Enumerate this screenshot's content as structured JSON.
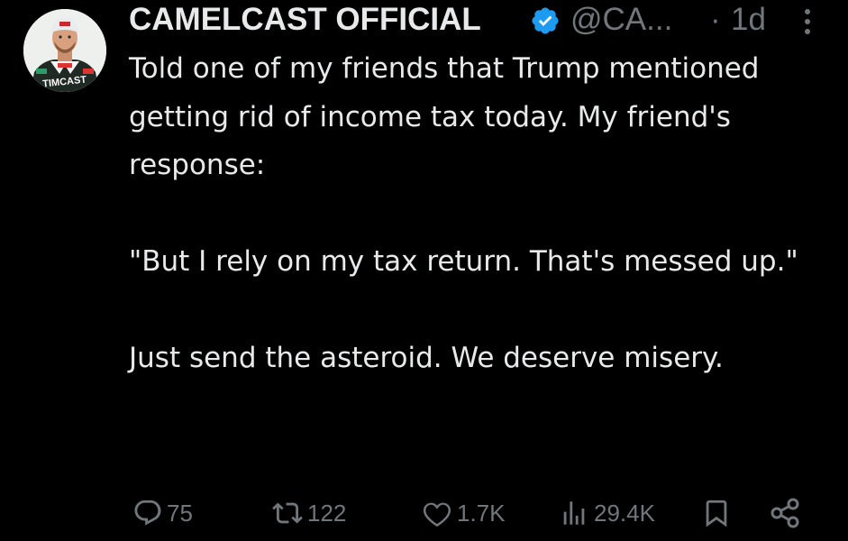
{
  "tweet": {
    "author": {
      "display_name": "CAMELCAST OFFICIAL",
      "handle": "@CA...",
      "verified": true,
      "avatar_caption": "TIMCAST"
    },
    "separator": "·",
    "time": "1d",
    "paragraphs": [
      "Told one of my friends that Trump mentioned getting rid of income tax today. My friend's response:",
      "\"But I rely on my tax return. That's messed up.\"",
      "Just send the asteroid. We deserve misery."
    ],
    "actions": {
      "replies": "75",
      "reposts": "122",
      "likes": "1.7K",
      "views": "29.4K"
    }
  },
  "colors": {
    "background": "#000000",
    "text": "#e7e9ea",
    "muted": "#71767b",
    "verified": "#1d9bf0"
  },
  "icons": [
    "verified-badge-icon",
    "more-icon",
    "reply-icon",
    "repost-icon",
    "like-icon",
    "views-icon",
    "bookmark-icon",
    "share-icon"
  ]
}
